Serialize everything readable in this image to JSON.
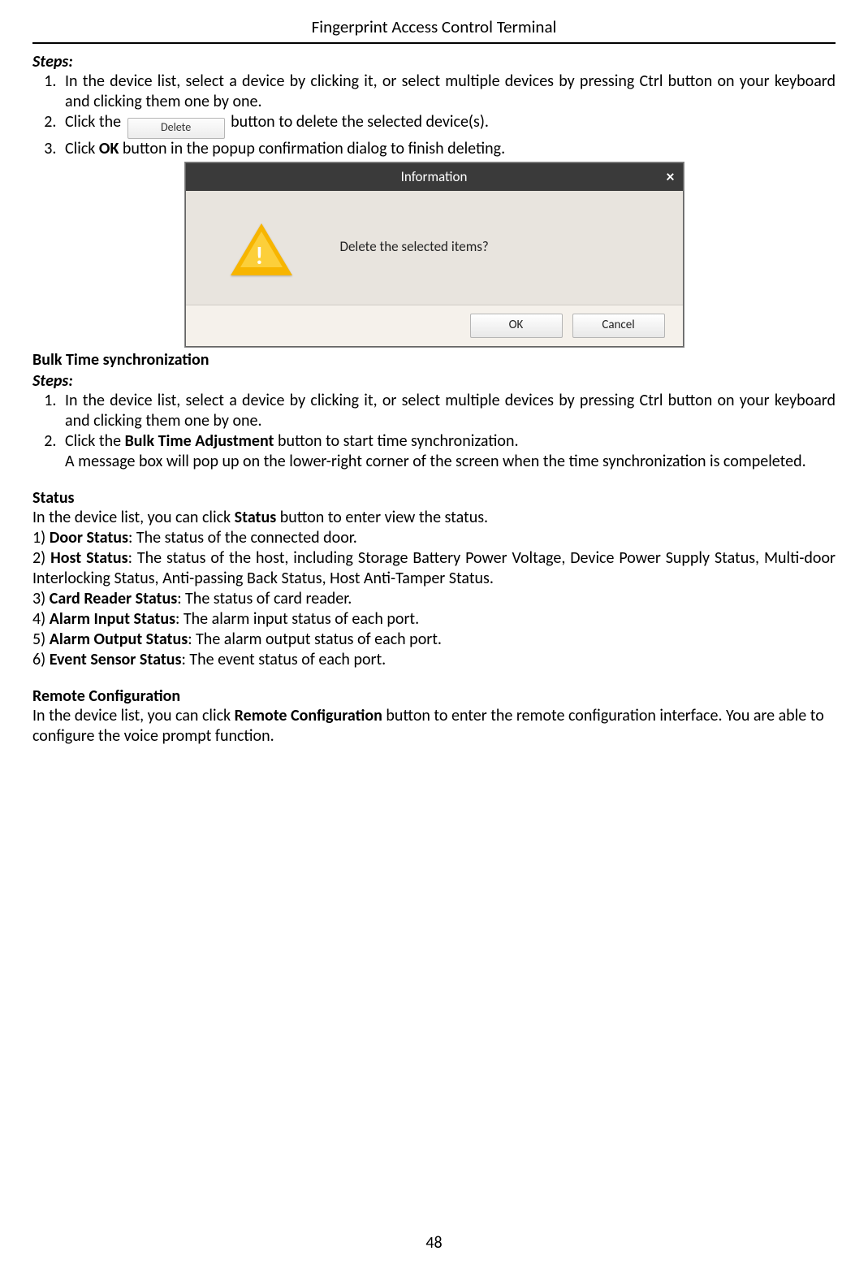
{
  "header": "Fingerprint Access Control Terminal",
  "page_number": "48",
  "sections": {
    "steps1_heading": "Steps:",
    "steps1": [
      {
        "text_a": "In the device list, select a device by clicking it, or select multiple devices by pressing Ctrl button on your keyboard and clicking them one by one."
      },
      {
        "text_a": "Click the ",
        "btn": "Delete",
        "text_b": " button to delete the selected device(s)."
      },
      {
        "text_a": "Click ",
        "bold": "OK",
        "text_b": " button in the popup confirmation dialog to finish deleting."
      }
    ],
    "dialog": {
      "title": "Information",
      "message": "Delete the selected items?",
      "ok": "OK",
      "cancel": "Cancel",
      "close": "×"
    },
    "bulk_heading": "Bulk Time synchronization",
    "steps2_heading": "Steps:",
    "steps2": [
      {
        "text_a": "In the device list, select a device by clicking it, or select multiple devices by pressing Ctrl button on your keyboard and clicking them one by one."
      },
      {
        "text_a": "Click the ",
        "bold": "Bulk Time Adjustment",
        "text_b": " button to start time synchronization.",
        "cont": "A message box will pop up on the lower-right corner of the screen when the time synchronization is compeleted."
      }
    ],
    "status_heading": "Status",
    "status_intro_a": "In the device list, you can click ",
    "status_intro_bold": "Status",
    "status_intro_b": " button to enter view the status.",
    "status_items": [
      {
        "n": "1)",
        "bold": "Door Status",
        "tail": ": The status of the connected door."
      },
      {
        "n": "2)",
        "bold": "Host Status",
        "tail": ": The status of the host, including Storage Battery Power Voltage, Device Power Supply Status, Multi-door Interlocking Status, Anti-passing Back Status, Host Anti-Tamper Status."
      },
      {
        "n": "3)",
        "bold": "Card Reader Status",
        "tail": ": The status of card reader."
      },
      {
        "n": "4)",
        "bold": "Alarm Input Status",
        "tail": ": The alarm input status of each port."
      },
      {
        "n": "5)",
        "bold": "Alarm Output Status",
        "tail": ": The alarm output status of each port."
      },
      {
        "n": "6)",
        "bold": "Event Sensor Status",
        "tail": ": The event status of each port."
      }
    ],
    "remote_heading": "Remote Configuration",
    "remote_a": "In the device list, you can click ",
    "remote_bold": "Remote Configuration",
    "remote_b": " button to enter the remote configuration interface. You are able to configure the voice prompt function."
  }
}
